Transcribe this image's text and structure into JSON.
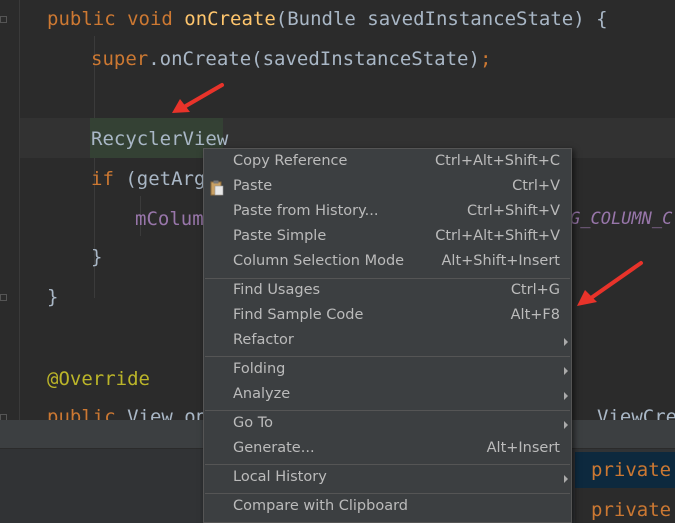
{
  "editor": {
    "line1": {
      "kw": "public void ",
      "fn": "onCreate",
      "rest": "(Bundle savedInstanceState) {"
    },
    "line2": {
      "kw": "super",
      "rest": ".onCreate(savedInstanceState)",
      "semi": ";"
    },
    "line4": {
      "text": "RecyclerView"
    },
    "line5": {
      "kw": "if ",
      "rest": "(getArg"
    },
    "line6": {
      "field": "mColumn",
      "const_tail": "G_COLUMN_C"
    },
    "line7": {
      "text": "}"
    },
    "line8": {
      "text": "}"
    },
    "line10": {
      "ann": "@Override"
    },
    "line11": {
      "kw": "public ",
      "rest": "View onC",
      "tail": "ViewCre"
    }
  },
  "popup": {
    "item1": "private",
    "item2": "private"
  },
  "context_menu": {
    "items": [
      {
        "label": "Copy Reference",
        "shortcut": "Ctrl+Alt+Shift+C"
      },
      {
        "label": "Paste",
        "shortcut": "Ctrl+V",
        "icon": "clipboard-icon"
      },
      {
        "label": "Paste from History...",
        "shortcut": "Ctrl+Shift+V"
      },
      {
        "label": "Paste Simple",
        "shortcut": "Ctrl+Alt+Shift+V"
      },
      {
        "label": "Column Selection Mode",
        "shortcut": "Alt+Shift+Insert"
      },
      {
        "label": "Find Usages",
        "shortcut": "Ctrl+G"
      },
      {
        "label": "Find Sample Code",
        "shortcut": "Alt+F8"
      },
      {
        "label": "Refactor",
        "submenu": true
      },
      {
        "label": "Folding",
        "submenu": true
      },
      {
        "label": "Analyze",
        "submenu": true
      },
      {
        "label": "Go To",
        "submenu": true
      },
      {
        "label": "Generate...",
        "shortcut": "Alt+Insert"
      },
      {
        "label": "Local History",
        "submenu": true
      },
      {
        "label": "Compare with Clipboard"
      }
    ]
  },
  "colors": {
    "editor_bg": "#2b2b2b",
    "keyword": "#cc7832",
    "method": "#ffc66d",
    "annotation": "#bbb529",
    "menu_bg": "#3c3f41",
    "arrow": "#e8332a"
  }
}
